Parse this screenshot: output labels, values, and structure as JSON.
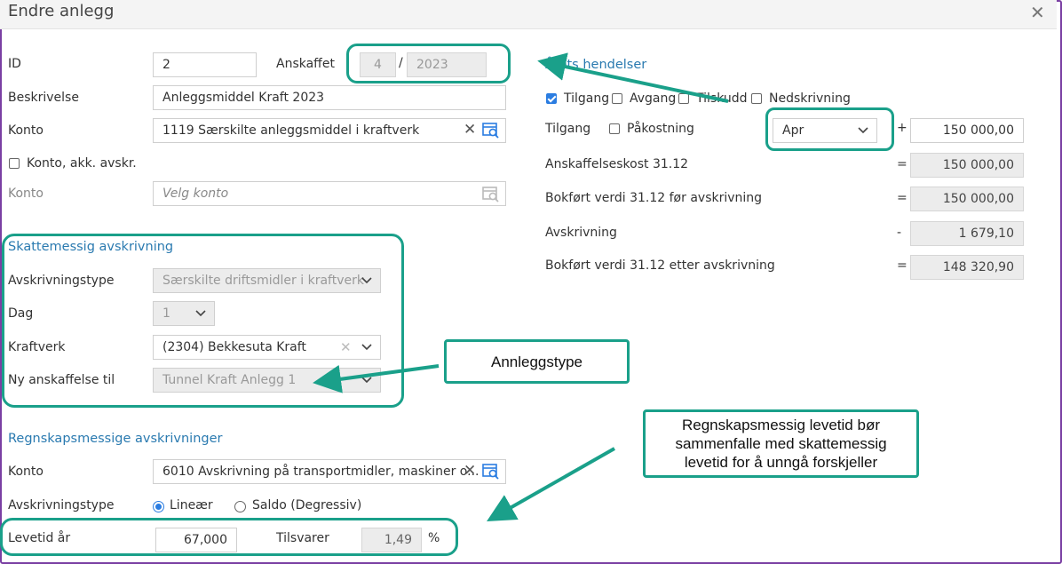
{
  "window": {
    "title": "Endre anlegg"
  },
  "left": {
    "id_label": "ID",
    "id_value": "2",
    "anskaffet_label": "Anskaffet",
    "anskaffet_month": "4",
    "anskaffet_sep": "/",
    "anskaffet_year": "2023",
    "beskrivelse_label": "Beskrivelse",
    "beskrivelse_value": "Anleggsmiddel Kraft 2023",
    "konto_label": "Konto",
    "konto_value": "1119 Særskilte anleggsmiddel i kraftverk",
    "akk_checkbox_label": "Konto, akk. avskr.",
    "konto2_label": "Konto",
    "konto2_placeholder": "Velg konto"
  },
  "skatt": {
    "heading": "Skattemessig avskrivning",
    "type_label": "Avskrivningstype",
    "type_value": "Særskilte driftsmidler i kraftverk",
    "dag_label": "Dag",
    "dag_value": "1",
    "kraftverk_label": "Kraftverk",
    "kraftverk_value": "(2304) Bekkesuta Kraft",
    "ny_label": "Ny anskaffelse til",
    "ny_value": "Tunnel Kraft Anlegg 1"
  },
  "regnskap": {
    "heading": "Regnskapsmessige avskrivninger",
    "konto_label": "Konto",
    "konto_value": "6010 Avskrivning på transportmidler, maskiner o...",
    "type_label": "Avskrivningstype",
    "radio_linear": "Lineær",
    "radio_saldo": "Saldo (Degressiv)",
    "levetid_label": "Levetid år",
    "levetid_value": "67,000",
    "tilsvarer_label": "Tilsvarer",
    "tilsvarer_value": "1,49",
    "percent": "%"
  },
  "right": {
    "heading": "Årets hendelser",
    "checks": {
      "tilgang": "Tilgang",
      "avgang": "Avgang",
      "tilskudd": "Tilskudd",
      "nedskrivning": "Nedskrivning"
    },
    "tilgang_label": "Tilgang",
    "pakostning_label": "Påkostning",
    "month_value": "Apr",
    "rows": [
      {
        "label": "Anskaffelseskost 31.12",
        "op": "=",
        "value": "150 000,00"
      },
      {
        "label": "Bokført verdi 31.12 før avskrivning",
        "op": "=",
        "value": "150 000,00"
      },
      {
        "label": "Avskrivning",
        "op": "-",
        "value": "1 679,10"
      },
      {
        "label": "Bokført verdi 31.12 etter avskrivning",
        "op": "=",
        "value": "148 320,90"
      }
    ],
    "tilgang_op": "+",
    "tilgang_value": "150 000,00"
  },
  "annotations": {
    "callout1": "Annleggstype",
    "callout2_line1": "Regnskapsmessig levetid bør",
    "callout2_line2": "sammenfalle med skattemessig",
    "callout2_line3": "levetid for å unngå forskjeller"
  },
  "colors": {
    "accent": "#2a7ab0",
    "highlight": "#1aa08a",
    "frame": "#7a3fa3"
  }
}
